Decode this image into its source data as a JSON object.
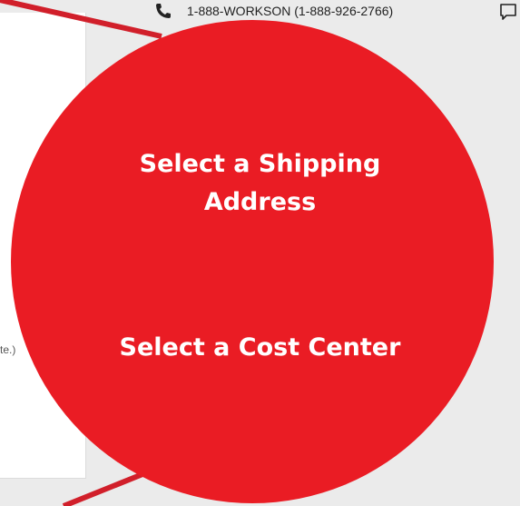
{
  "header": {
    "phone_text": "1-888-WORKSON (1-888-926-2766)",
    "phone_icon": "phone-icon",
    "chat_icon": "chat-bubble-icon"
  },
  "panel": {
    "truncated_text": "te.)"
  },
  "callouts": {
    "shipping_line1": "Select a Shipping",
    "shipping_line2": "Address",
    "cost_center": "Select a Cost Center"
  },
  "colors": {
    "callout_red": "#ea1c24",
    "arrow_red": "#d11f2a",
    "background": "#ebebeb"
  }
}
